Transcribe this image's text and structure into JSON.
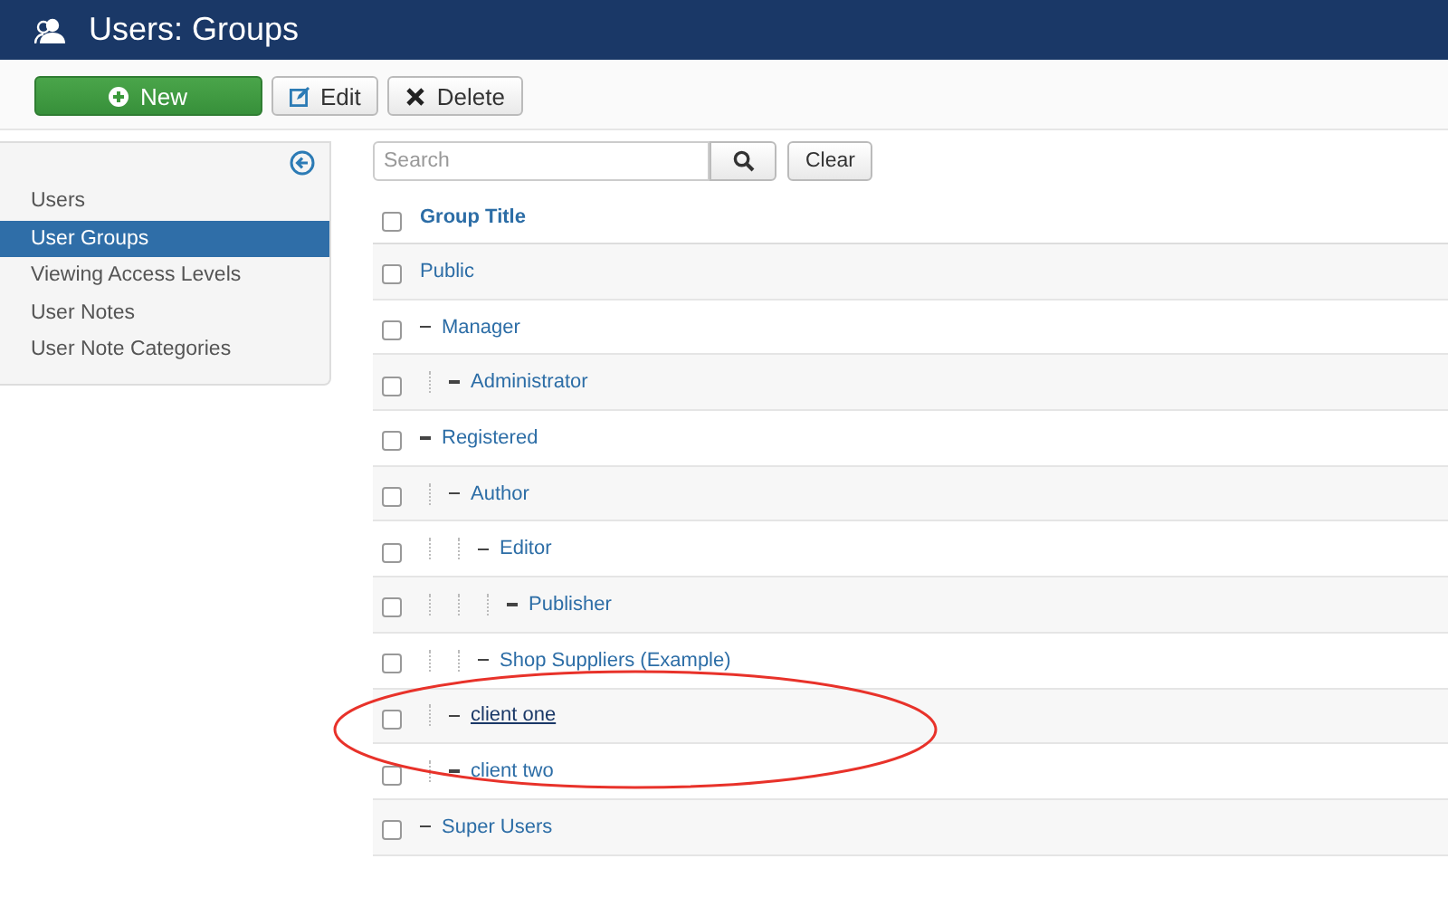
{
  "header": {
    "title": "Users: Groups"
  },
  "toolbar": {
    "buttons": [
      {
        "kind": "new",
        "label": "New"
      },
      {
        "kind": "edit",
        "label": "Edit"
      },
      {
        "kind": "delete",
        "label": "Delete"
      }
    ]
  },
  "sidebar": {
    "items": [
      {
        "label": "Users",
        "selected": false
      },
      {
        "label": "User Groups",
        "selected": true
      },
      {
        "label": "Viewing Access Levels",
        "selected": false
      },
      {
        "label": "User Notes",
        "selected": false
      },
      {
        "label": "User Note Categories",
        "selected": false
      }
    ]
  },
  "search": {
    "placeholder": "Search",
    "clear_label": "Clear"
  },
  "table": {
    "header": {
      "label": "Group Title",
      "checked": false
    },
    "rows": [
      {
        "title": "Public",
        "checked": false,
        "hovered": false,
        "children": [
          {
            "title": "Manager",
            "checked": false,
            "hovered": false,
            "children": [
              {
                "title": "Administrator",
                "checked": false,
                "hovered": false
              }
            ]
          },
          {
            "title": "Registered",
            "checked": false,
            "hovered": false,
            "children": [
              {
                "title": "Author",
                "checked": false,
                "hovered": false,
                "children": [
                  {
                    "title": "Editor",
                    "checked": false,
                    "hovered": false,
                    "children": [
                      {
                        "title": "Publisher",
                        "checked": false,
                        "hovered": false
                      }
                    ]
                  },
                  {
                    "title": "Shop Suppliers (Example)",
                    "checked": false,
                    "hovered": false
                  }
                ]
              },
              {
                "title": "client one",
                "checked": false,
                "hovered": true
              },
              {
                "title": "client two",
                "checked": false,
                "hovered": false
              }
            ]
          },
          {
            "title": "Super Users",
            "checked": false,
            "hovered": false
          }
        ]
      }
    ]
  },
  "annotations": [
    {
      "kind": "ellipse",
      "color": "#e8322a"
    }
  ]
}
